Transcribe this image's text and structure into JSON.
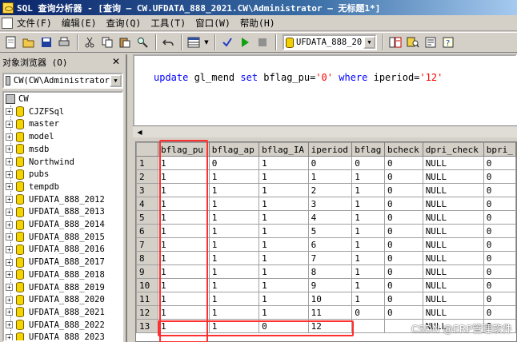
{
  "window": {
    "title": "SQL 查询分析器 - [查询 — CW.UFDATA_888_2021.CW\\Administrator — 无标题1*]"
  },
  "menu": [
    "文件(F)",
    "编辑(E)",
    "查询(Q)",
    "工具(T)",
    "窗口(W)",
    "帮助(H)"
  ],
  "toolbar": {
    "database": "UFDATA_888_20",
    "icons": [
      "new-query-icon",
      "open-icon",
      "save-icon",
      "print-icon",
      "cut-icon",
      "copy-icon",
      "paste-icon",
      "find-icon",
      "undo-icon",
      "grid-results-icon",
      "parse-check-icon",
      "execute-icon",
      "stop-icon",
      "database-icon",
      "object-browser-icon",
      "object-search-icon",
      "properties-icon",
      "help-icon"
    ]
  },
  "object_browser": {
    "title": "对象浏览器 (O)",
    "connection": "CW(CW\\Administrator",
    "root": "CW",
    "databases": [
      "CJZFSql",
      "master",
      "model",
      "msdb",
      "Northwind",
      "pubs",
      "tempdb",
      "UFDATA_888_2012",
      "UFDATA_888_2013",
      "UFDATA_888_2014",
      "UFDATA_888_2015",
      "UFDATA_888_2016",
      "UFDATA_888_2017",
      "UFDATA_888_2018",
      "UFDATA_888_2019",
      "UFDATA_888_2020",
      "UFDATA_888_2021",
      "UFDATA_888_2022",
      "UFDATA_888_2023"
    ]
  },
  "editor": {
    "tokens": {
      "update": "update",
      "table": " gl_mend ",
      "set": "set",
      "col1": " bflag_pu=",
      "val1": "'0'",
      "where": "where",
      "col2": " iperiod=",
      "val2": "'12'"
    }
  },
  "results": {
    "columns": [
      "bflag_pu",
      "bflag_ap",
      "bflag_IA",
      "iperiod",
      "bflag",
      "bcheck",
      "dpri_check",
      "bpri_"
    ],
    "rows": [
      [
        "1",
        "1",
        "0",
        "1",
        "0",
        "0",
        "0",
        "NULL",
        "0"
      ],
      [
        "2",
        "1",
        "1",
        "1",
        "1",
        "1",
        "0",
        "NULL",
        "0"
      ],
      [
        "3",
        "1",
        "1",
        "1",
        "2",
        "1",
        "0",
        "NULL",
        "0"
      ],
      [
        "4",
        "1",
        "1",
        "1",
        "3",
        "1",
        "0",
        "NULL",
        "0"
      ],
      [
        "5",
        "1",
        "1",
        "1",
        "4",
        "1",
        "0",
        "NULL",
        "0"
      ],
      [
        "6",
        "1",
        "1",
        "1",
        "5",
        "1",
        "0",
        "NULL",
        "0"
      ],
      [
        "7",
        "1",
        "1",
        "1",
        "6",
        "1",
        "0",
        "NULL",
        "0"
      ],
      [
        "8",
        "1",
        "1",
        "1",
        "7",
        "1",
        "0",
        "NULL",
        "0"
      ],
      [
        "9",
        "1",
        "1",
        "1",
        "8",
        "1",
        "0",
        "NULL",
        "0"
      ],
      [
        "10",
        "1",
        "1",
        "1",
        "9",
        "1",
        "0",
        "NULL",
        "0"
      ],
      [
        "11",
        "1",
        "1",
        "1",
        "10",
        "1",
        "0",
        "NULL",
        "0"
      ],
      [
        "12",
        "1",
        "1",
        "1",
        "11",
        "0",
        "0",
        "NULL",
        "0"
      ],
      [
        "13",
        "1",
        "1",
        "0",
        "12",
        "",
        "",
        "NULL",
        "0"
      ]
    ]
  },
  "watermark": "CSDN @ERP管理软件",
  "colors": {
    "highlight": "#ff3030",
    "keyword": "#0000ff",
    "string": "#ff0000"
  }
}
